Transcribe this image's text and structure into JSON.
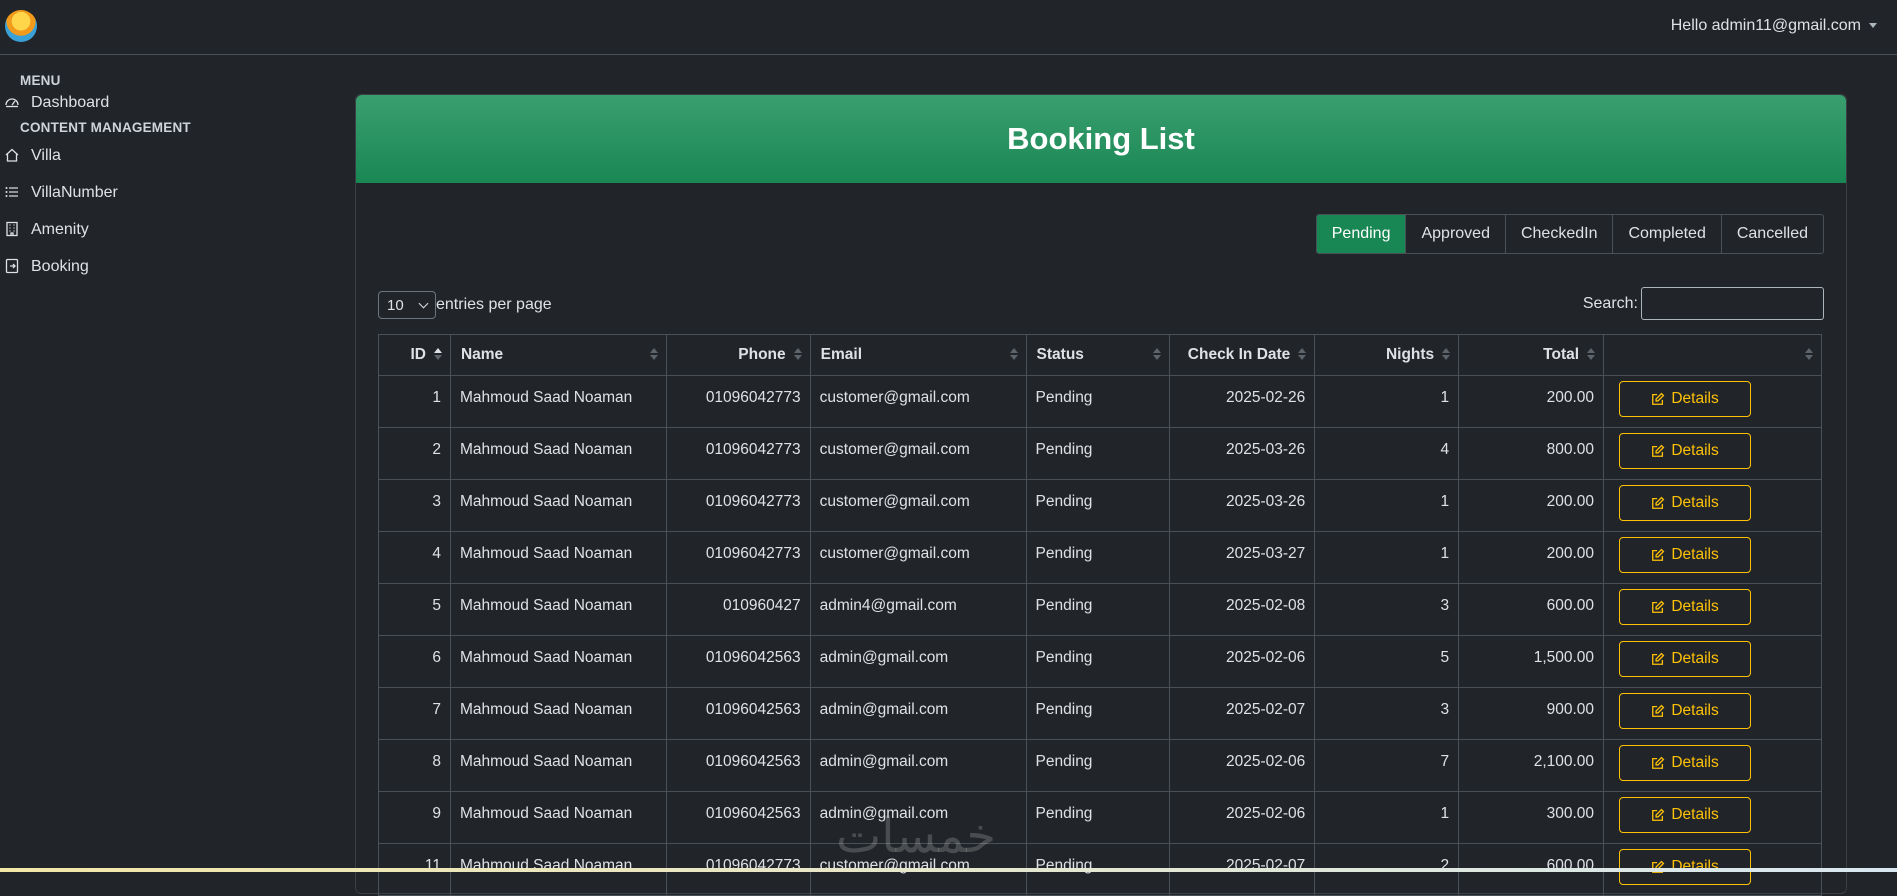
{
  "header": {
    "user_greeting": "Hello admin11@gmail.com"
  },
  "sidebar": {
    "menu_heading": "MENU",
    "dashboard": "Dashboard",
    "content_heading": "CONTENT MANAGEMENT",
    "items": [
      {
        "label": "Villa",
        "icon": "house-icon"
      },
      {
        "label": "VillaNumber",
        "icon": "list-icon"
      },
      {
        "label": "Amenity",
        "icon": "building-icon"
      },
      {
        "label": "Booking",
        "icon": "booking-icon"
      }
    ]
  },
  "page": {
    "title": "Booking List"
  },
  "status_filter": {
    "active": "Pending",
    "options": [
      "Pending",
      "Approved",
      "CheckedIn",
      "Completed",
      "Cancelled"
    ]
  },
  "table_controls": {
    "per_page_value": "10",
    "per_page_label": "entries per page",
    "search_label": "Search:",
    "search_value": ""
  },
  "table": {
    "columns": [
      "ID",
      "Name",
      "Phone",
      "Email",
      "Status",
      "Check In Date",
      "Nights",
      "Total",
      ""
    ],
    "action_label": "Details",
    "rows": [
      [
        "1",
        "Mahmoud Saad Noaman",
        "01096042773",
        "customer@gmail.com",
        "Pending",
        "2025-02-26",
        "1",
        "200.00"
      ],
      [
        "2",
        "Mahmoud Saad Noaman",
        "01096042773",
        "customer@gmail.com",
        "Pending",
        "2025-03-26",
        "4",
        "800.00"
      ],
      [
        "3",
        "Mahmoud Saad Noaman",
        "01096042773",
        "customer@gmail.com",
        "Pending",
        "2025-03-26",
        "1",
        "200.00"
      ],
      [
        "4",
        "Mahmoud Saad Noaman",
        "01096042773",
        "customer@gmail.com",
        "Pending",
        "2025-03-27",
        "1",
        "200.00"
      ],
      [
        "5",
        "Mahmoud Saad Noaman",
        "010960427",
        "admin4@gmail.com",
        "Pending",
        "2025-02-08",
        "3",
        "600.00"
      ],
      [
        "6",
        "Mahmoud Saad Noaman",
        "01096042563",
        "admin@gmail.com",
        "Pending",
        "2025-02-06",
        "5",
        "1,500.00"
      ],
      [
        "7",
        "Mahmoud Saad Noaman",
        "01096042563",
        "admin@gmail.com",
        "Pending",
        "2025-02-07",
        "3",
        "900.00"
      ],
      [
        "8",
        "Mahmoud Saad Noaman",
        "01096042563",
        "admin@gmail.com",
        "Pending",
        "2025-02-06",
        "7",
        "2,100.00"
      ],
      [
        "9",
        "Mahmoud Saad Noaman",
        "01096042563",
        "admin@gmail.com",
        "Pending",
        "2025-02-06",
        "1",
        "300.00"
      ],
      [
        "11",
        "Mahmoud Saad Noaman",
        "01096042773",
        "customer@gmail.com",
        "Pending",
        "2025-02-07",
        "2",
        "600.00"
      ]
    ]
  },
  "watermark": "خمسات"
}
